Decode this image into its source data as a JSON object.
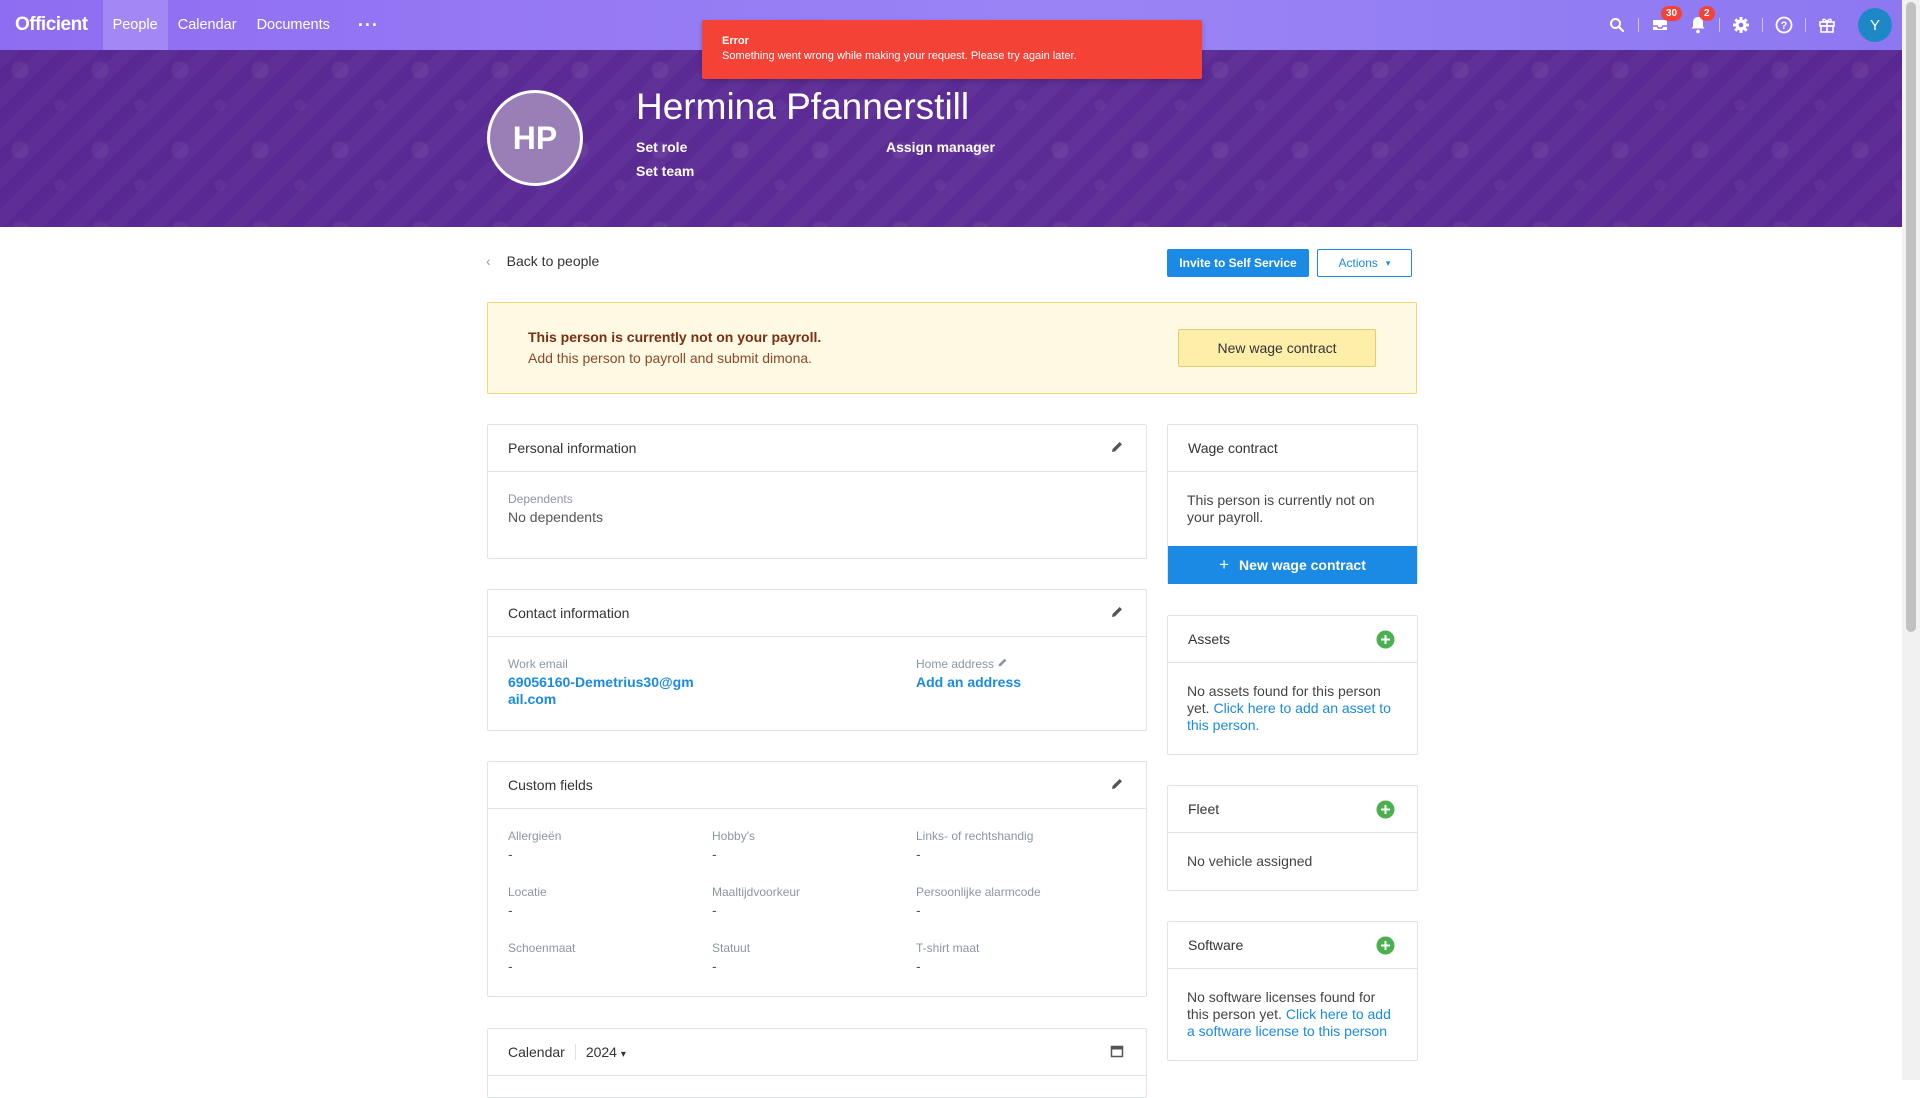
{
  "nav": {
    "logo": "Officient",
    "items": [
      {
        "label": "People",
        "active": true
      },
      {
        "label": "Calendar",
        "active": false
      },
      {
        "label": "Documents",
        "active": false
      }
    ],
    "more": "···",
    "inbox_badge": "30",
    "notif_badge": "2",
    "user_initial": "Y"
  },
  "toast": {
    "title": "Error",
    "message": "Something went wrong while making your request. Please try again later."
  },
  "header": {
    "initials": "HP",
    "name": "Hermina Pfannerstill",
    "set_role": "Set role",
    "set_team": "Set team",
    "assign_manager": "Assign manager"
  },
  "toolbar": {
    "back": "Back to people",
    "invite": "Invite to Self Service",
    "actions": "Actions"
  },
  "payroll_warning": {
    "title": "This person is currently not on your payroll.",
    "subtitle": "Add this person to payroll and submit dimona.",
    "button": "New wage contract"
  },
  "personal": {
    "title": "Personal information",
    "dependents_label": "Dependents",
    "dependents_value": "No dependents"
  },
  "contact": {
    "title": "Contact information",
    "work_email_label": "Work email",
    "work_email_line1": "69056160-Demetrius30@gm",
    "work_email_line2": "ail.com",
    "home_address_label": "Home address",
    "home_address_link": "Add an address"
  },
  "custom_fields": {
    "title": "Custom fields",
    "fields": [
      {
        "label": "Allergieën",
        "value": "-"
      },
      {
        "label": "Hobby's",
        "value": "-"
      },
      {
        "label": "Links- of rechtshandig",
        "value": "-"
      },
      {
        "label": "Locatie",
        "value": "-"
      },
      {
        "label": "Maaltijdvoorkeur",
        "value": "-"
      },
      {
        "label": "Persoonlijke alarmcode",
        "value": "-"
      },
      {
        "label": "Schoenmaat",
        "value": "-"
      },
      {
        "label": "Statuut",
        "value": "-"
      },
      {
        "label": "T-shirt maat",
        "value": "-"
      }
    ]
  },
  "calendar": {
    "title": "Calendar",
    "year": "2024"
  },
  "wage_contract": {
    "title": "Wage contract",
    "text_line1": "This person is currently not on",
    "text_line2": "your payroll.",
    "button": "New wage contract"
  },
  "assets": {
    "title": "Assets",
    "text_line1": "No assets found for this person",
    "text_line2_plain": "yet.",
    "link_line2": "Click here to add an asset to",
    "link_line3": "this person."
  },
  "fleet": {
    "title": "Fleet",
    "text": "No vehicle assigned"
  },
  "software": {
    "title": "Software",
    "text_line1": "No software licenses found for",
    "text_line2_plain": "this person yet.",
    "link_line2": "Click here to add",
    "link_line3": "a software license to this person"
  },
  "colors": {
    "nav_bg": "#8f6df2",
    "banner_bg": "#5a2a91",
    "primary": "#1a8ae5",
    "error": "#f44336",
    "warning_bg": "#fef9e3",
    "success": "#4caf50"
  }
}
